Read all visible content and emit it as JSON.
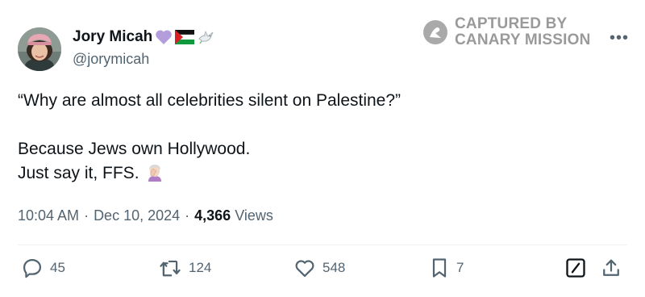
{
  "author": {
    "display_name": "Jory Micah",
    "handle": "@jorymicah",
    "name_badges": [
      "purple-heart-icon",
      "palestine-flag-icon",
      "dove-icon"
    ]
  },
  "watermark": {
    "line1": "CAPTURED BY",
    "line2": "CANARY MISSION"
  },
  "tweet": {
    "lines": [
      "“Why are almost all celebrities silent on Palestine?”",
      "Because Jews own Hollywood.",
      "Just say it, FFS."
    ],
    "trailing_emoji": "face-palm-emoji"
  },
  "meta": {
    "time": "10:04 AM",
    "separator": "·",
    "date": "Dec 10, 2024",
    "views_count": "4,366",
    "views_label": "Views"
  },
  "actions": {
    "replies": "45",
    "reposts": "124",
    "likes": "548",
    "bookmarks": "7"
  },
  "colors": {
    "text_primary": "#0f1419",
    "text_secondary": "#536471",
    "watermark": "#9a9a9a",
    "divider": "#eff3f4",
    "heart_badge": "#b39ddb"
  }
}
